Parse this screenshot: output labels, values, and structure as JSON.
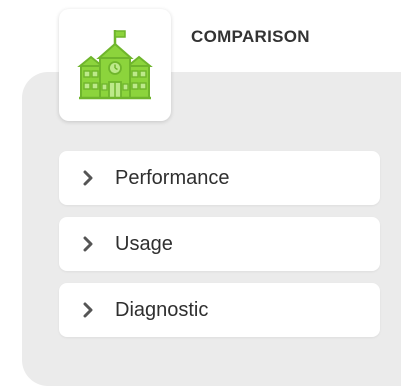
{
  "header": {
    "title": "COMPARISON",
    "icon": "school-building-icon",
    "icon_color": "#8cd43c"
  },
  "menu": {
    "items": [
      {
        "label": "Performance",
        "icon": "chevron-right-icon"
      },
      {
        "label": "Usage",
        "icon": "chevron-right-icon"
      },
      {
        "label": "Diagnostic",
        "icon": "chevron-right-icon"
      }
    ]
  },
  "colors": {
    "panel_background": "#ebebeb",
    "card_background": "#ffffff",
    "chevron": "#555555",
    "text": "#2f2f2f"
  }
}
